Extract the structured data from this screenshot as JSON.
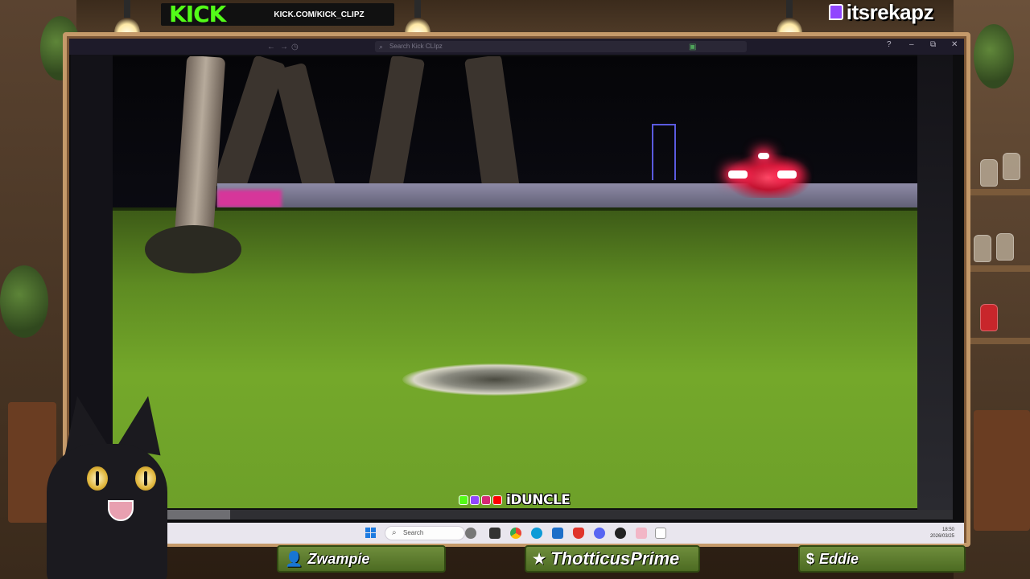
{
  "kick_banner": {
    "logo": "KICK",
    "url": "KICK.COM/KICK_CLIPZ"
  },
  "twitch": {
    "username": "itsrekapz"
  },
  "browser": {
    "search_placeholder": "Search Kick CLIpz",
    "controls": {
      "help": "?",
      "minimize": "–",
      "maximize": "⧉",
      "close": "✕"
    }
  },
  "video": {
    "watermark": "iDUNCLE",
    "progress": 0.14
  },
  "taskbar": {
    "search_label": "Search",
    "clock_time": "18:50",
    "clock_date": "2026/03/25"
  },
  "plates": [
    {
      "icon": "user-icon",
      "glyph": "👤",
      "name": "Zwampie"
    },
    {
      "icon": "star-icon",
      "glyph": "★",
      "name": "ThotticusPrime"
    },
    {
      "icon": "dollar-icon",
      "glyph": "$",
      "name": "Eddie"
    }
  ],
  "colors": {
    "kick_green": "#53fc18",
    "twitch_purple": "#9146ff",
    "plate_green": "#5d7d2f"
  }
}
